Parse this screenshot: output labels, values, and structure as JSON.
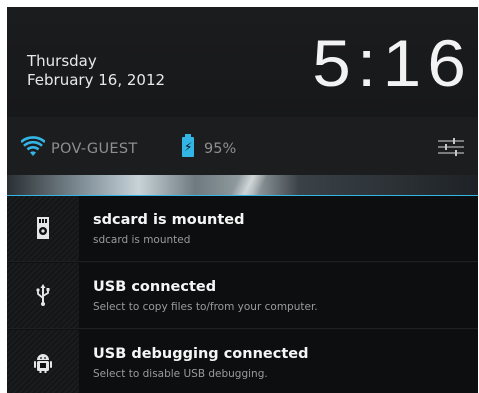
{
  "header": {
    "day": "Thursday",
    "date": "February 16, 2012",
    "time": "5:16"
  },
  "status": {
    "network_name": "POV-GUEST",
    "battery_percent": "95%",
    "icons": [
      "wifi-icon",
      "battery-charging-icon",
      "quick-settings-icon"
    ]
  },
  "notifications": [
    {
      "icon": "sdcard-icon",
      "title": "sdcard is mounted",
      "subtitle": "sdcard is mounted"
    },
    {
      "icon": "usb-icon",
      "title": "USB connected",
      "subtitle": "Select to copy files to/from your computer."
    },
    {
      "icon": "android-debug-icon",
      "title": "USB debugging connected",
      "subtitle": "Select to disable USB debugging."
    }
  ],
  "colors": {
    "accent": "#33b5e5",
    "background": "#101112"
  }
}
